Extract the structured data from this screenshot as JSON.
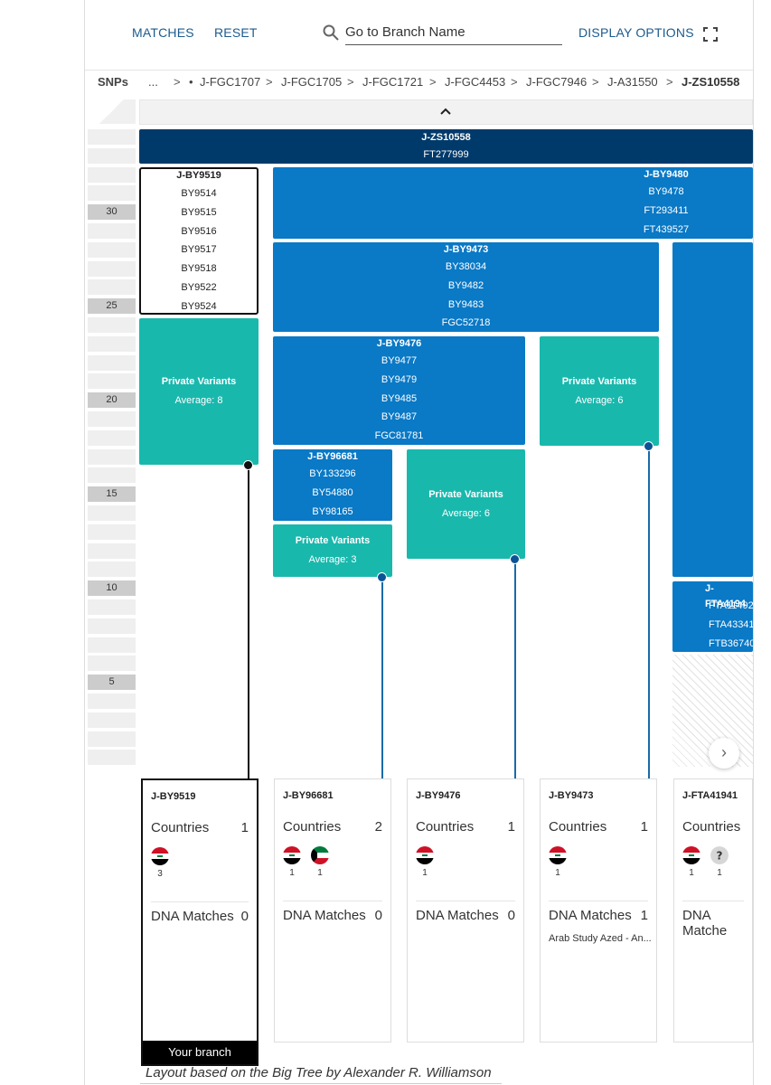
{
  "toolbar": {
    "matches_label": "MATCHES",
    "reset_label": "RESET",
    "search_placeholder": "Go to Branch Name",
    "display_options_label": "DISPLAY OPTIONS"
  },
  "breadcrumb": {
    "axis_label": "SNPs",
    "ellipsis": "...",
    "items": [
      "J-FGC1707",
      "J-FGC1705",
      "J-FGC1721",
      "J-FGC4453",
      "J-FGC7946",
      "J-A31550"
    ],
    "current": "J-ZS10558",
    "separator": ">",
    "bullet": "•"
  },
  "axis": {
    "labels": [
      "30",
      "25",
      "20",
      "15",
      "10",
      "5"
    ]
  },
  "blocks": {
    "zs10558": {
      "name": "J-ZS10558",
      "snps": [
        "FT277999"
      ]
    },
    "by9519": {
      "name": "J-BY9519",
      "snps": [
        "BY9514",
        "BY9515",
        "BY9516",
        "BY9517",
        "BY9518",
        "BY9522",
        "BY9524"
      ]
    },
    "by9480": {
      "name": "J-BY9480",
      "snps": [
        "BY9478",
        "FT293411",
        "FT439527"
      ]
    },
    "by9473": {
      "name": "J-BY9473",
      "snps": [
        "BY38034",
        "BY9482",
        "BY9483",
        "FGC52718"
      ]
    },
    "by9476": {
      "name": "J-BY9476",
      "snps": [
        "BY9477",
        "BY9479",
        "BY9485",
        "BY9487",
        "FGC81781"
      ]
    },
    "by96681": {
      "name": "J-BY96681",
      "snps": [
        "BY133296",
        "BY54880",
        "BY98165"
      ]
    },
    "fta41941": {
      "name": "J-FTA4194",
      "snps": [
        "FTA11492",
        "FTA43341",
        "FTB36740"
      ]
    },
    "pv1": {
      "title": "Private Variants",
      "avg": "Average: 8"
    },
    "pv2": {
      "title": "Private Variants",
      "avg": "Average: 6"
    },
    "pv3": {
      "title": "Private Variants",
      "avg": "Average: 6"
    },
    "pv4": {
      "title": "Private Variants",
      "avg": "Average: 3"
    }
  },
  "cards": [
    {
      "name": "J-BY9519",
      "countries_label": "Countries",
      "countries": "1",
      "flags": [
        {
          "flag": "iraq-flag",
          "count": "3"
        }
      ],
      "matches_label": "DNA Matches",
      "matches": "0",
      "note": "",
      "your_branch": "Your branch"
    },
    {
      "name": "J-BY96681",
      "countries_label": "Countries",
      "countries": "2",
      "flags": [
        {
          "flag": "iraq-flag",
          "count": "1"
        },
        {
          "flag": "kuwait-flag",
          "count": "1"
        }
      ],
      "matches_label": "DNA Matches",
      "matches": "0",
      "note": ""
    },
    {
      "name": "J-BY9476",
      "countries_label": "Countries",
      "countries": "1",
      "flags": [
        {
          "flag": "iraq-flag",
          "count": "1"
        }
      ],
      "matches_label": "DNA Matches",
      "matches": "0",
      "note": ""
    },
    {
      "name": "J-BY9473",
      "countries_label": "Countries",
      "countries": "1",
      "flags": [
        {
          "flag": "iraq-flag",
          "count": "1"
        }
      ],
      "matches_label": "DNA Matches",
      "matches": "1",
      "note": "Arab Study Azed - An..."
    },
    {
      "name": "J-FTA41941",
      "countries_label": "Countries",
      "countries": "",
      "flags": [
        {
          "flag": "iraq-flag",
          "count": "1"
        },
        {
          "flag": "unknown-flag",
          "count": "1"
        }
      ],
      "matches_label": "DNA Matche",
      "matches": "",
      "note": ""
    }
  ],
  "footer": {
    "text": "Layout based on the Big Tree by Alexander R. Williamson"
  },
  "colors": {
    "dark": "#003a6b",
    "mid": "#0a79c6",
    "teal": "#19b8ad",
    "link": "#1c5b8e"
  }
}
